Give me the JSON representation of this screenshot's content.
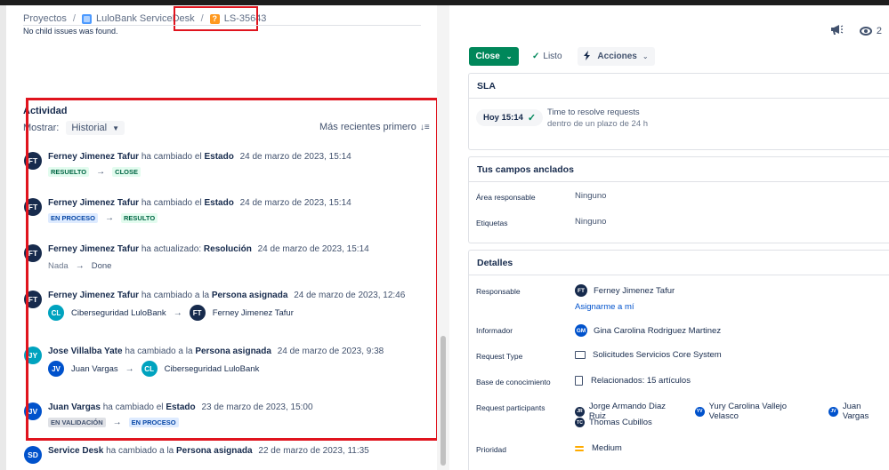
{
  "breadcrumb": {
    "projects": "Proyectos",
    "project": "LuloBank ServiceDesk",
    "issue_key": "LS-35643",
    "sep": "/"
  },
  "no_child": "No child issues was found.",
  "activity": {
    "title": "Actividad",
    "show_label": "Mostrar:",
    "show_value": "Historial",
    "sort_label": "Más recientes primero",
    "entries": [
      {
        "initials": "FT",
        "actor": "Ferney Jimenez Tafur",
        "action": "ha cambiado el",
        "field": "Estado",
        "date": "24 de marzo de 2023, 15:14",
        "from": "RESUELTO",
        "to": "CLOSE"
      },
      {
        "initials": "FT",
        "actor": "Ferney Jimenez Tafur",
        "action": "ha cambiado el",
        "field": "Estado",
        "date": "24 de marzo de 2023, 15:14",
        "from": "EN PROCESO",
        "to": "RESULTO"
      },
      {
        "initials": "FT",
        "actor": "Ferney Jimenez Tafur",
        "action": "ha actualizado:",
        "field": "Resolución",
        "date": "24 de marzo de 2023, 15:14",
        "from": "Nada",
        "to": "Done"
      },
      {
        "initials": "FT",
        "actor": "Ferney Jimenez Tafur",
        "action": "ha cambiado a la",
        "field": "Persona asignada",
        "date": "24 de marzo de 2023, 12:46",
        "from_initials": "CL",
        "from": "Ciberseguridad LuloBank",
        "to_initials": "FT",
        "to": "Ferney Jimenez Tafur"
      },
      {
        "initials": "JY",
        "actor": "Jose Villalba Yate",
        "action": "ha cambiado a la",
        "field": "Persona asignada",
        "date": "24 de marzo de 2023, 9:38",
        "from_initials": "JV",
        "from": "Juan Vargas",
        "to_initials": "CL",
        "to": "Ciberseguridad LuloBank"
      },
      {
        "initials": "JV",
        "actor": "Juan Vargas",
        "action": "ha cambiado el",
        "field": "Estado",
        "date": "23 de marzo de 2023, 15:00",
        "from": "EN VALIDACIÓN",
        "to": "EN PROCESO"
      },
      {
        "initials": "SD",
        "actor": "Service Desk",
        "action": "ha cambiado a la",
        "field": "Persona asignada",
        "date": "22 de marzo de 2023, 11:35"
      }
    ],
    "arrow": "→"
  },
  "toolbar": {
    "watch_count": "2",
    "close_label": "Close",
    "listo_label": "Listo",
    "acciones_label": "Acciones"
  },
  "sla": {
    "title": "SLA",
    "chip": "Hoy 15:14",
    "text1": "Time to resolve requests",
    "text2": "dentro de un plazo de 24 h"
  },
  "pinned": {
    "title": "Tus campos anclados",
    "area_label": "Área responsable",
    "area_value": "Ninguno",
    "tags_label": "Etiquetas",
    "tags_value": "Ninguno"
  },
  "details": {
    "title": "Detalles",
    "responsable_label": "Responsable",
    "responsable_initials": "FT",
    "responsable_value": "Ferney Jimenez Tafur",
    "assign_me": "Asignarme a mí",
    "informador_label": "Informador",
    "informador_initials": "GM",
    "informador_value": "Gina Carolina Rodriguez Martinez",
    "request_type_label": "Request Type",
    "request_type_value": "Solicitudes Servicios Core System",
    "kb_label": "Base de conocimiento",
    "kb_value": "Relacionados: 15 artículos",
    "participants_label": "Request participants",
    "participants": [
      {
        "initials": "JR",
        "name": "Jorge Armando Diaz Ruiz"
      },
      {
        "initials": "YV",
        "name": "Yury Carolina Vallejo Velasco"
      },
      {
        "initials": "JV",
        "name": "Juan Vargas"
      },
      {
        "initials": "TC",
        "name": "Thomas Cubillos"
      }
    ],
    "priority_label": "Prioridad",
    "priority_value": "Medium"
  },
  "colors": {
    "close_green": "#00875a",
    "highlight_red": "#e0141e",
    "link_blue": "#0052cc"
  }
}
